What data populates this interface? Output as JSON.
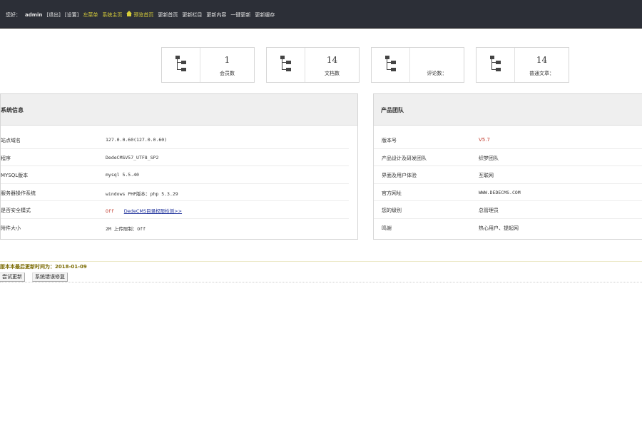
{
  "topbar": {
    "greeting": "您好：",
    "username": "admin",
    "logout": "[退出]",
    "settings": "[设置]",
    "left_menu": "左菜单",
    "system_home": "系统主页",
    "preview_home": "预览首页",
    "menu": [
      "更新首页",
      "更新栏目",
      "更新内容",
      "一键更新",
      "更新缓存"
    ]
  },
  "stats": [
    {
      "value": "1",
      "label": "会员数"
    },
    {
      "value": "14",
      "label": "文档数"
    },
    {
      "value": "",
      "label": "评论数："
    },
    {
      "value": "14",
      "label": "普通文章："
    }
  ],
  "system_panel": {
    "title": "系统信息",
    "rows": [
      {
        "key": "站点域名",
        "value": "127.0.0.60(127.0.0.60)"
      },
      {
        "key": "程序",
        "value": "DedeCMSV57_UTF8_SP2"
      },
      {
        "key": "MYSQL版本",
        "value": "mysql 5.5.40"
      },
      {
        "key": "服务器操作系统",
        "value": "windows PHP版本：php 5.3.29"
      },
      {
        "key": "是否安全模式",
        "value": "Off",
        "link": "DedeCMS目录权限检测>>"
      },
      {
        "key": "附件大小",
        "value": "2M 上传限制：Off"
      }
    ]
  },
  "product_panel": {
    "title": "产品团队",
    "rows": [
      {
        "key": "版本号",
        "value": "V5.7"
      },
      {
        "key": "产品设计及研发团队",
        "value": "织梦团队"
      },
      {
        "key": "界面及用户体验",
        "value": "互联网"
      },
      {
        "key": "官方网址",
        "value": "WWW.DEDECMS.COM"
      },
      {
        "key": "您的级别",
        "value": "总管理员"
      },
      {
        "key": "鸣谢",
        "value": "热心用户、提起网"
      }
    ]
  },
  "update_notice": "版本本最后更新时间为：2018-01-09",
  "buttons": {
    "check_update": "尝试更新",
    "repair": "系统错误修复"
  },
  "colors": {
    "topbar_bg": "#2c2f37",
    "accent_yellow": "#d8ce3a",
    "red": "#c0392b",
    "link": "#1b2e9a",
    "notice": "#7a6a00"
  },
  "icons": {
    "home": "home-icon",
    "stat": "tree-structure-icon"
  }
}
